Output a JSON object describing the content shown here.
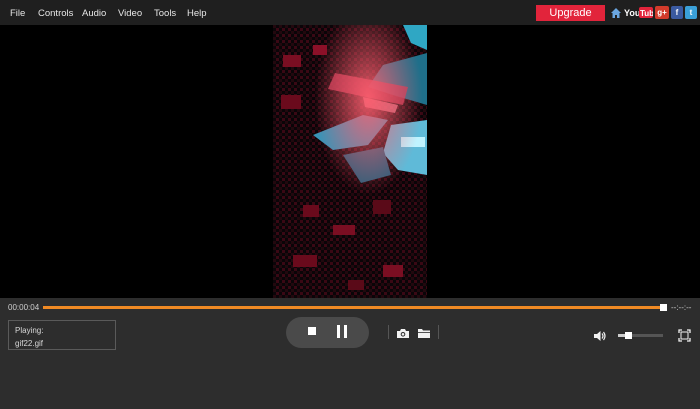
{
  "menu": {
    "items": [
      "File",
      "Controls",
      "Audio",
      "Video",
      "Tools",
      "Help"
    ]
  },
  "header": {
    "upgrade_label": "Upgrade",
    "youtube_label": "YouTube",
    "gplus_label": "g+",
    "facebook_label": "f",
    "twitter_label": "t"
  },
  "player": {
    "current_time": "00:00:04",
    "total_time": "--:--:--",
    "progress": 0.995,
    "volume": 0.15,
    "playing_label": "Playing:",
    "file_name": "gif22.gif",
    "state": "playing"
  },
  "colors": {
    "accent_progress": "#f08a24",
    "upgrade": "#e2243b",
    "background": "#2d2d2d",
    "menubar": "#1f1f1f"
  },
  "icons": {
    "home": "home-icon",
    "stop": "stop-icon",
    "pause": "pause-icon",
    "snapshot": "camera-icon",
    "open": "folder-icon",
    "volume": "volume-icon",
    "fullscreen": "fullscreen-icon"
  }
}
